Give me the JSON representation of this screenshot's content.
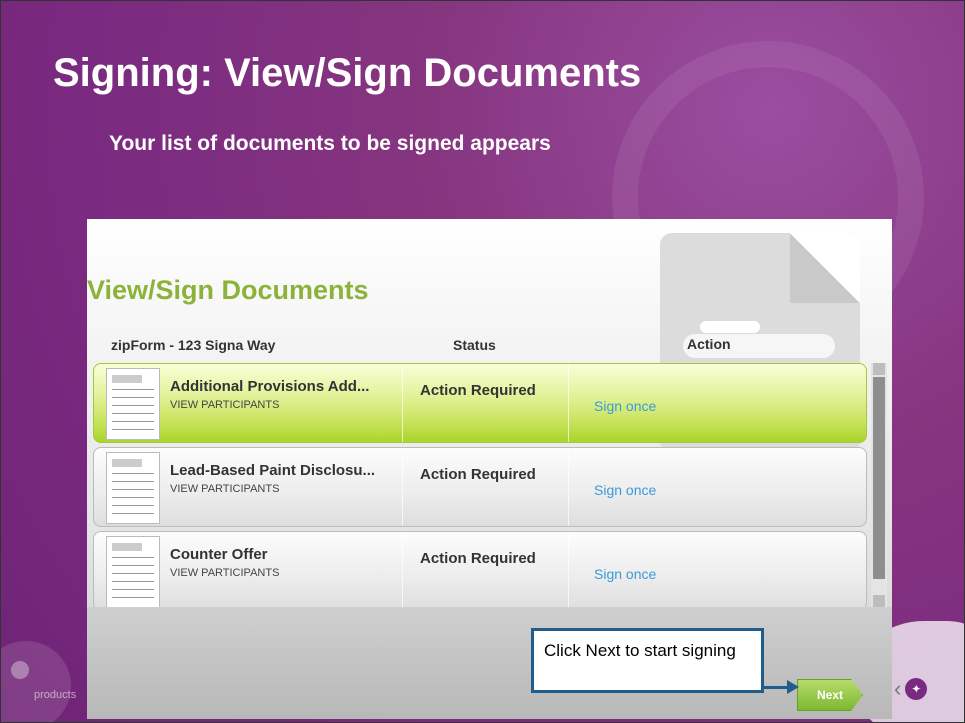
{
  "slide": {
    "title": "Signing: View/Sign Documents",
    "subtitle": "Your list of documents to be signed appears",
    "footer_brand": "products"
  },
  "app": {
    "title": "View/Sign Documents",
    "columns": {
      "file": "zipForm - 123 Signa Way",
      "status": "Status",
      "action": "Action"
    },
    "documents": [
      {
        "name": "Additional Provisions Add...",
        "sub": "VIEW PARTICIPANTS",
        "status": "Action Required",
        "action": "Sign once",
        "selected": true
      },
      {
        "name": "Lead-Based Paint Disclosu...",
        "sub": "VIEW PARTICIPANTS",
        "status": "Action Required",
        "action": "Sign once",
        "selected": false
      },
      {
        "name": "Counter Offer",
        "sub": "VIEW PARTICIPANTS",
        "status": "Action Required",
        "action": "Sign once",
        "selected": false
      }
    ],
    "next_label": "Next"
  },
  "callout": {
    "text": "Click Next to start signing"
  },
  "colors": {
    "slide_bg": "#7a2a80",
    "title_green": "#8bb33a",
    "selected_row": "#c7e35a",
    "link_blue": "#3a9ad9",
    "callout_border": "#1f5e8c",
    "next_green": "#7db832"
  }
}
